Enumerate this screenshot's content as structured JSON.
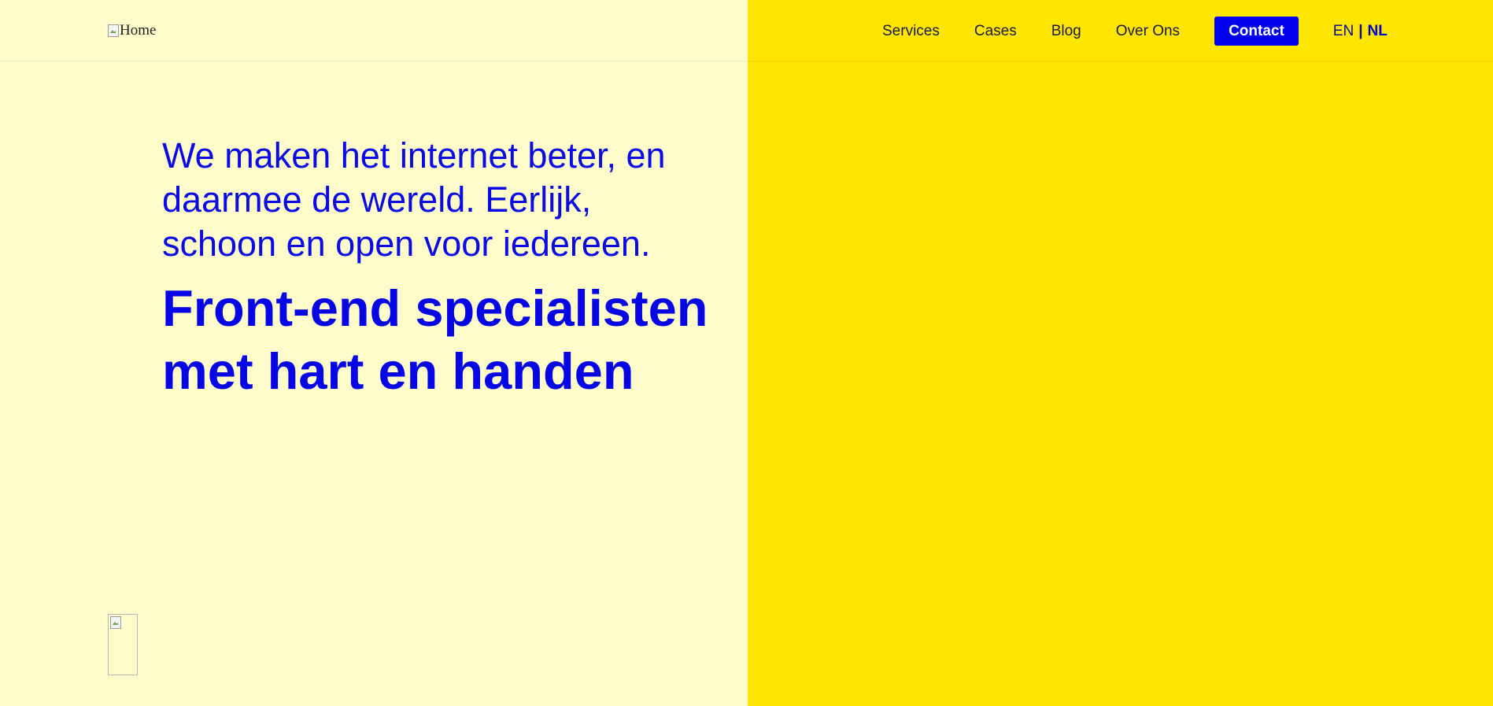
{
  "logo": {
    "alt_text": "Home",
    "icon": "broken-image-icon"
  },
  "nav": {
    "items": [
      {
        "label": "Services"
      },
      {
        "label": "Cases"
      },
      {
        "label": "Blog"
      },
      {
        "label": "Over Ons"
      }
    ],
    "contact_label": "Contact"
  },
  "language": {
    "en": "EN",
    "separator": "|",
    "nl": "NL",
    "active": "NL"
  },
  "hero": {
    "intro": "We maken het internet beter, en daarmee de wereld. Eerlijk, schoon en open voor iedereen.",
    "headline": "Front-end specialisten met hart en handen"
  },
  "decor_image": {
    "icon": "broken-image-icon"
  },
  "colors": {
    "left_background": "#fffccc",
    "right_background": "#ffe600",
    "accent_blue": "#0000ee",
    "contact_text": "#ffffff"
  }
}
